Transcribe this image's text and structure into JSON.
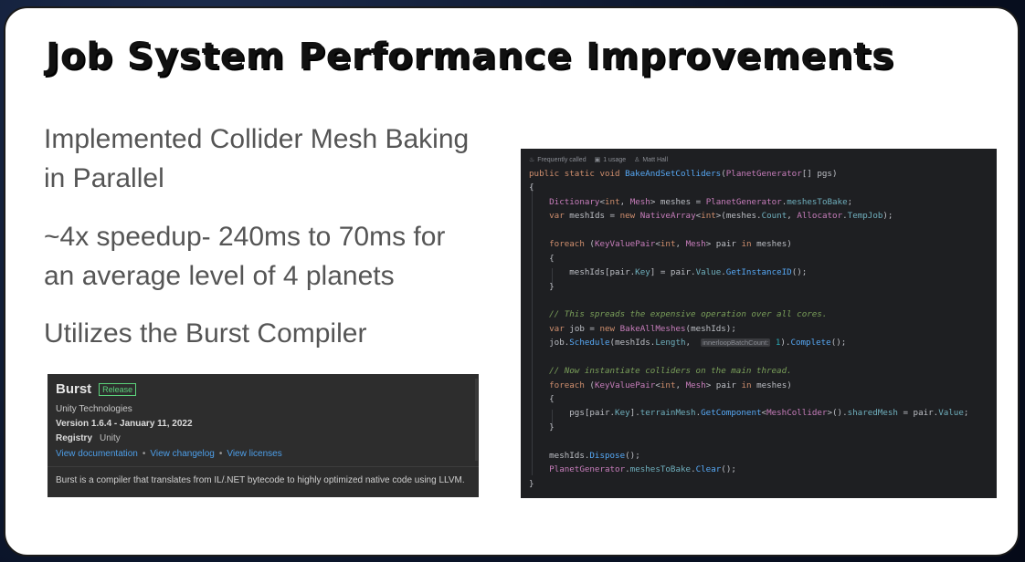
{
  "slide": {
    "title": "Job System Performance Improvements",
    "bullets": [
      {
        "line1": "Implemented Collider Mesh Baking",
        "line2": "in Parallel"
      },
      {
        "line1": "~4x speedup- 240ms to 70ms for",
        "line2": "an average level of 4 planets"
      },
      {
        "line1": "Utilizes the Burst Compiler"
      }
    ]
  },
  "burst_panel": {
    "name": "Burst",
    "badge": "Release",
    "company": "Unity Technologies",
    "version": "Version 1.6.4 - January 11, 2022",
    "registry_label": "Registry",
    "registry_value": "Unity",
    "links": [
      "View documentation",
      "View changelog",
      "View licenses"
    ],
    "link_separator": "•",
    "description": "Burst is a compiler that translates from IL/.NET bytecode to highly optimized native code using LLVM."
  },
  "code_panel": {
    "meta": {
      "frequently_called": "Frequently called",
      "usages": "1 usage",
      "author": "Matt Hall"
    },
    "icons": {
      "frequently_called": "flame-icon",
      "usages": "usage-icon",
      "author": "person-icon"
    },
    "hint_label": "innerloopBatchCount:",
    "colors": {
      "keyword": "#cf8e6d",
      "type": "#c77dbb",
      "method": "#56a8f5",
      "field": "#6fafbd",
      "comment": "#7a9f5a",
      "number": "#2aacb8",
      "background": "#1e1f22"
    }
  }
}
